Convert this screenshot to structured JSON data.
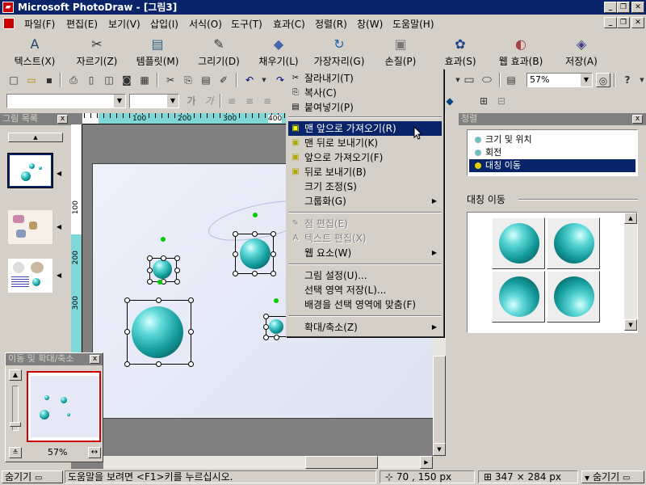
{
  "window": {
    "title": "Microsoft PhotoDraw - [그림3]",
    "app_icon": "photodraw-icon"
  },
  "menubar": [
    "파일(F)",
    "편집(E)",
    "보기(V)",
    "삽입(I)",
    "서식(O)",
    "도구(T)",
    "효과(C)",
    "정렬(R)",
    "창(W)",
    "도움말(H)"
  ],
  "big_toolbar": [
    {
      "label": "텍스트(X)",
      "icon": "A"
    },
    {
      "label": "자르기(Z)",
      "icon": "✂"
    },
    {
      "label": "템플릿(M)",
      "icon": "▤"
    },
    {
      "label": "그리기(D)",
      "icon": "✎"
    },
    {
      "label": "채우기(L)",
      "icon": "◆"
    },
    {
      "label": "가장자리(G)",
      "icon": "↻"
    },
    {
      "label": "손질(P)",
      "icon": "▣"
    },
    {
      "label": "효과(S)",
      "icon": "✿"
    },
    {
      "label": "웹 효과(B)",
      "icon": "◐"
    },
    {
      "label": "저장(A)",
      "icon": "◈"
    }
  ],
  "zoom": {
    "value": "57%"
  },
  "font_controls": {
    "bold_label": "가",
    "italic_label": "가"
  },
  "ruler_h": [
    "100",
    "200",
    "300",
    "400"
  ],
  "ruler_v": [
    "100",
    "200",
    "300"
  ],
  "picture_list": {
    "title": "그림 목록",
    "close": "x"
  },
  "context_menu": {
    "items": [
      {
        "label": "잘라내기(T)",
        "icon": "✂",
        "disabled": false,
        "submenu": false
      },
      {
        "label": "복사(C)",
        "icon": "⎘",
        "disabled": false,
        "submenu": false
      },
      {
        "label": "붙여넣기(P)",
        "icon": "▤",
        "disabled": false,
        "submenu": false
      },
      {
        "label": "맨 앞으로 가져오기(R)",
        "icon": "▣",
        "disabled": false,
        "submenu": false,
        "highlight": true
      },
      {
        "label": "맨 뒤로 보내기(K)",
        "icon": "▣",
        "disabled": false,
        "submenu": false
      },
      {
        "label": "앞으로 가져오기(F)",
        "icon": "▣",
        "disabled": false,
        "submenu": false
      },
      {
        "label": "뒤로 보내기(B)",
        "icon": "▣",
        "disabled": false,
        "submenu": false
      },
      {
        "label": "크기 조정(S)",
        "icon": "",
        "disabled": false,
        "submenu": false
      },
      {
        "label": "그룹화(G)",
        "icon": "",
        "disabled": false,
        "submenu": true
      },
      {
        "label": "점 편집(E)",
        "icon": "✎",
        "disabled": true,
        "submenu": false
      },
      {
        "label": "텍스트 편집(X)",
        "icon": "A",
        "disabled": true,
        "submenu": false
      },
      {
        "label": "웹 요소(W)",
        "icon": "",
        "disabled": false,
        "submenu": true
      },
      {
        "label": "그림 설정(U)...",
        "icon": "",
        "disabled": false,
        "submenu": false
      },
      {
        "label": "선택 영역 저장(L)...",
        "icon": "",
        "disabled": false,
        "submenu": false
      },
      {
        "label": "배경을 선택 영역에 맞춤(F)",
        "icon": "",
        "disabled": false,
        "submenu": false
      },
      {
        "label": "확대/축소(Z)",
        "icon": "",
        "disabled": false,
        "submenu": true
      }
    ]
  },
  "arrange_panel": {
    "title": "정렬",
    "options": [
      {
        "label": "크기 및 위치",
        "selected": false
      },
      {
        "label": "회전",
        "selected": false
      },
      {
        "label": "대칭 이동",
        "selected": true
      }
    ],
    "section_label": "대칭 이동"
  },
  "pan_zoom": {
    "title": "이동 및 확대/축소",
    "zoom_label": "57%"
  },
  "statusbar": {
    "left_toggle": "숨기기",
    "help_text": "도움말을 보려면 <F1>키를 누르십시오.",
    "position": "70 , 150  px",
    "size": "347 × 284  px",
    "right_toggle": "숨기기"
  }
}
